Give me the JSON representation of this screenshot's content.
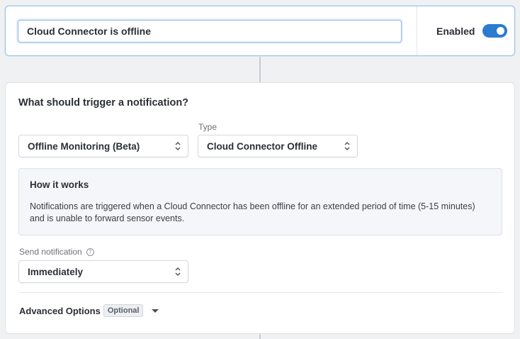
{
  "title_input": {
    "value": "Cloud Connector is offline"
  },
  "toggle": {
    "label": "Enabled",
    "on": true
  },
  "trigger": {
    "heading": "What should trigger a notification?",
    "category_select": {
      "value": "Offline Monitoring (Beta)"
    },
    "type_select": {
      "label": "Type",
      "value": "Cloud Connector Offline"
    }
  },
  "how_it_works": {
    "title": "How it works",
    "text": "Notifications are triggered when a Cloud Connector has been offline for an extended period of time (5-15 minutes) and is unable to forward sensor events."
  },
  "send_notification": {
    "label": "Send notification",
    "value": "Immediately",
    "info_icon": "?"
  },
  "advanced": {
    "label": "Advanced Options",
    "badge": "Optional"
  },
  "colors": {
    "accent": "#2b7bcf",
    "background": "#f0f1f3"
  }
}
